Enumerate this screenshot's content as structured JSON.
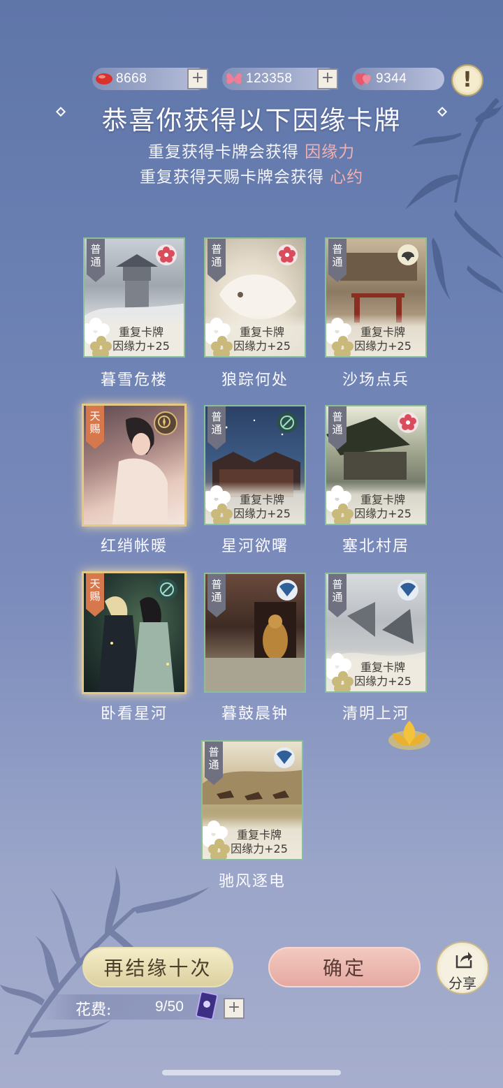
{
  "resources": [
    {
      "icon": "red-bean-icon",
      "value": "8668"
    },
    {
      "icon": "butterfly-icon",
      "value": "123358"
    },
    {
      "icon": "hearts-icon",
      "value": "9344"
    }
  ],
  "plus_symbol": "+",
  "alert_symbol": "!",
  "header": {
    "title": "恭喜你获得以下因缘卡牌",
    "line1_text": "重复获得卡牌会获得",
    "line1_highlight": "因缘力",
    "line2_text": "重复获得天赐卡牌会获得",
    "line2_highlight": "心约"
  },
  "dup_line1": "重复卡牌",
  "dup_line2": "因缘力+25",
  "cards": [
    {
      "name": "暮雪危楼",
      "rarity": "普通",
      "duplicate": true
    },
    {
      "name": "狼踪何处",
      "rarity": "普通",
      "duplicate": true
    },
    {
      "name": "沙场点兵",
      "rarity": "普通",
      "duplicate": true
    },
    {
      "name": "红绡帐暖",
      "rarity": "天赐",
      "duplicate": false
    },
    {
      "name": "星河欲曙",
      "rarity": "普通",
      "duplicate": true
    },
    {
      "name": "塞北村居",
      "rarity": "普通",
      "duplicate": true
    },
    {
      "name": "卧看星河",
      "rarity": "天赐",
      "duplicate": false
    },
    {
      "name": "暮鼓晨钟",
      "rarity": "普通",
      "duplicate": false
    },
    {
      "name": "清明上河",
      "rarity": "普通",
      "duplicate": true
    },
    {
      "name": "驰风逐电",
      "rarity": "普通",
      "duplicate": true
    }
  ],
  "buttons": {
    "again": "再结缘十次",
    "confirm": "确定",
    "share": "分享"
  },
  "cost": {
    "label": "花费:",
    "value": "9/50"
  },
  "colors": {
    "bg_top": "#5f76a9",
    "bg_bottom": "#a7aecd",
    "highlight": "#f3b0b0",
    "confirm_button": "#e4a9a1",
    "again_button": "#dcd0a0"
  }
}
